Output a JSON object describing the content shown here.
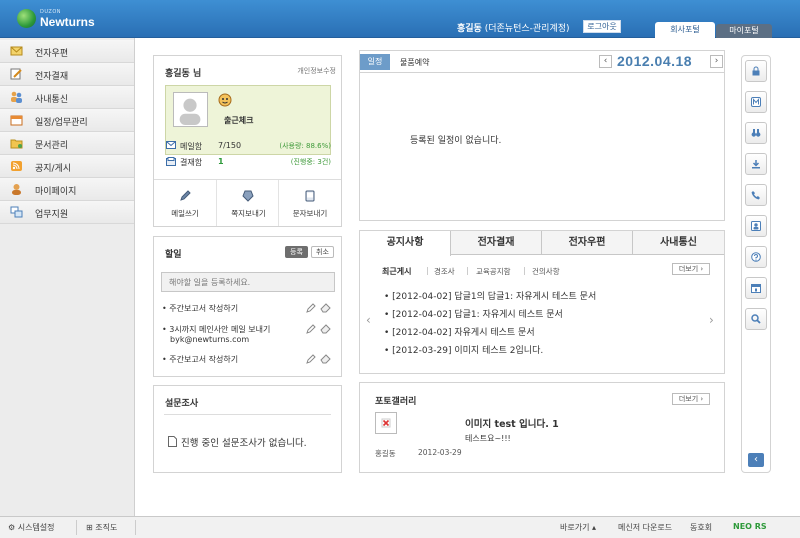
{
  "header": {
    "logo_sub": "DUZON",
    "logo_name": "Newturns",
    "user_name": "홍길동",
    "user_org": "(더존뉴턴스-관리계정)",
    "logout": "로그아웃",
    "tabs": [
      "회사포털",
      "마이포털"
    ]
  },
  "sidebar": {
    "items": [
      "전자우편",
      "전자결재",
      "사내통신",
      "일정/업무관리",
      "문서관리",
      "공지/게시",
      "마이페이지",
      "업무지원"
    ]
  },
  "profile": {
    "name": "홍길동 님",
    "edit_link": "개인정보수정",
    "checkin": "출근체크",
    "mail_label": "메일함",
    "mail_count": "7/150",
    "mail_usage": "(사용량: 88.6%)",
    "approval_label": "결재함",
    "approval_count": "1",
    "approval_progress": "(진행중: 3건)",
    "actions": [
      "메일쓰기",
      "쪽지보내기",
      "문자보내기"
    ]
  },
  "todo": {
    "title": "할일",
    "register": "등록",
    "cancel": "취소",
    "placeholder": "해야할 일을 등록하세요.",
    "items": [
      "주간보고서 작성하기",
      "3시까지 메인사안 메일 보내기",
      "주간보고서 작성하기"
    ],
    "item2_email": "byk@newturns.com"
  },
  "survey": {
    "title": "설문조사",
    "empty": "진행 중인 설문조사가 없습니다."
  },
  "schedule": {
    "tab_active": "일정",
    "tab_other": "물품예약",
    "date": "2012.04.18",
    "empty": "등록된 일정이 없습니다."
  },
  "board": {
    "tabs": [
      "공지사항",
      "전자결재",
      "전자우편",
      "사내통신"
    ],
    "subtabs": [
      "최근게시",
      "경조사",
      "교육공지함",
      "건의사항"
    ],
    "more": "더보기",
    "posts": [
      {
        "date": "[2012-04-02]",
        "title": "답글1의 답글1: 자유게시 테스트 문서"
      },
      {
        "date": "[2012-04-02]",
        "title": "답글1: 자유게시 테스트 문서"
      },
      {
        "date": "[2012-04-02]",
        "title": "자유게시 테스트 문서"
      },
      {
        "date": "[2012-03-29]",
        "title": "이미지 테스트 2입니다."
      }
    ]
  },
  "gallery": {
    "title": "포토갤러리",
    "more": "더보기",
    "item_title": "이미지 test 입니다. 1",
    "item_desc": "테스트요~!!!",
    "author": "홍길동",
    "date": "2012-03-29"
  },
  "footer": {
    "settings": "시스템설정",
    "org": "조직도",
    "shortcut": "바로가기",
    "messenger": "메신저 다운로드",
    "club": "동호회",
    "brand": "NEO RS"
  },
  "colors": {
    "header_blue": "#2f7cc4",
    "date_blue": "#4a7fb0",
    "brand_green": "#2e9a3a"
  }
}
